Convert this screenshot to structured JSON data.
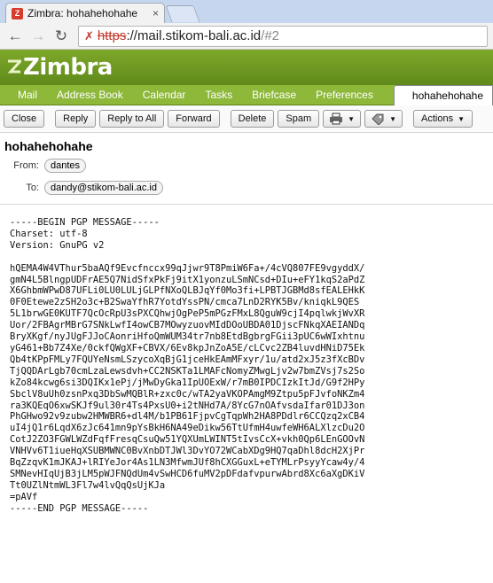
{
  "browser": {
    "tab_title": "Zimbra: hohahehohahe",
    "tab_favicon_glyph": "Z",
    "tab_close_glyph": "×",
    "url_https": "https",
    "url_host": "://mail.stikom-bali.ac.id",
    "url_rest": "/#2"
  },
  "app": {
    "logo": "Zimbra",
    "tabs": [
      "Mail",
      "Address Book",
      "Calendar",
      "Tasks",
      "Briefcase",
      "Preferences"
    ],
    "active_tab": "hohahehohahe"
  },
  "actions": {
    "close": "Close",
    "reply": "Reply",
    "reply_all": "Reply to All",
    "forward": "Forward",
    "delete": "Delete",
    "spam": "Spam",
    "actions": "Actions"
  },
  "message": {
    "subject": "hohahehohahe",
    "from_label": "From:",
    "from": "dantes",
    "to_label": "To:",
    "to": "dandy@stikom-bali.ac.id",
    "body": "-----BEGIN PGP MESSAGE-----\nCharset: utf-8\nVersion: GnuPG v2\n\nhQEMA4W4VThur5baAQf9Evcfnccx99qJjwr9T8PmiW6Fa+/4cVQ807FE9vgyddX/\ngmN4L5BlngpUDFrAE5Q7NidSfxPkFj9itX1yonzuLSmNCsd+DIu+eFY1kqS2aPdZ\nX6GhbmWPwD87UFLi0LU0LULjGLPfNXoQLBJqYf0Mo3fi+LPBTJGBMd8sfEALEHkK\n0F0Etewe2zSH2o3c+B2SwaYfhR7YotdYssPN/cmca7LnD2RYK5Bv/kniqkL9QES\n5L1brwGE0KUTF7QcOcRpU3sPXCQhwjOgPeP5mPGzFMxL8QguW9cjI4pqlwkjWvXR\nUor/2FBAgrMBrG7SNkLwfI4owCB7MOwyzuovMIdDOoUBDA01DjscFNkqXAEIANDq\nBryXKgf/nyJUgFJJoCAonriHfoQmWUM34tr7nb8EtdBgbrgFGii3pUC6wWIxhtnu\nyG461+Bb7Z4Xe/0ckfQWgXF+CBVX/6Ev8kpJnZoA5E/cLCvc2ZB4luvdHNiD75Ek\nQb4tKPpFMLy7FQUYeNsmLSzycoXqBjG1jceHkEAmMFxyr/1u/atd2xJ5z3fXcBDv\nTjQQDArLgb70cmLzaLewsdvh+CC2NSKTa1LMAFcNomyZMwgLjv2w7bmZVsj7s2So\nkZo84kcwg6si3DQIKx1ePj/jMwDyGka1IpUOExW/r7mB0IPDCIzkItJd/G9f2HPy\nSbclV8uUh0zsnPxq3DbSwMQBlR+zxc0c/wTA2yaVKOPAmgM9Ztpu5pFJvfoNKZm4\nra3KQEqO6xwSKJf9ul30r4Ts4PxsU0+i2tNHd7A/8YcG7nOAfvsdaIfar01DJ3on\nPhGHwo92v9zubw2HMWBR6+dl4M/b1PB61FjpvCgTqpWh2HA8PDdlr6CCQzq2xCB4\nuI4jQ1r6LqdX6zJc641mn9pYsBkH6NA49eDikw56TtUfmH4uwfeWH6ALXlzcDu2O\nCotJ2ZO3FGWLWZdFqfFresqCsuQw51YQXUmLWINT5tIvsCcX+vkh0Qp6LEnGOOvN\nVNHVv6T1iueHqXSUBMWNC0BvXnbDTJWl3DvYO72WCabXDg9HQ7qaDhl8dcH2XjPr\nBqZzqvK1mJKAJ+lRIYeJor4As1LN3MfwmJUf8hCXGGuxL+eTYMLrPsyyYcaw4y/4\nSMNevHIqUjB3jLM5pWJFNQdUm4vSwHCD6fuMV2pDFdafvpurwAbrd8Xc6aXgDKiV\nTt0UZlNtmWL3Fl7w4lvQqQsUjKJa\n=pAVf\n-----END PGP MESSAGE-----"
  }
}
